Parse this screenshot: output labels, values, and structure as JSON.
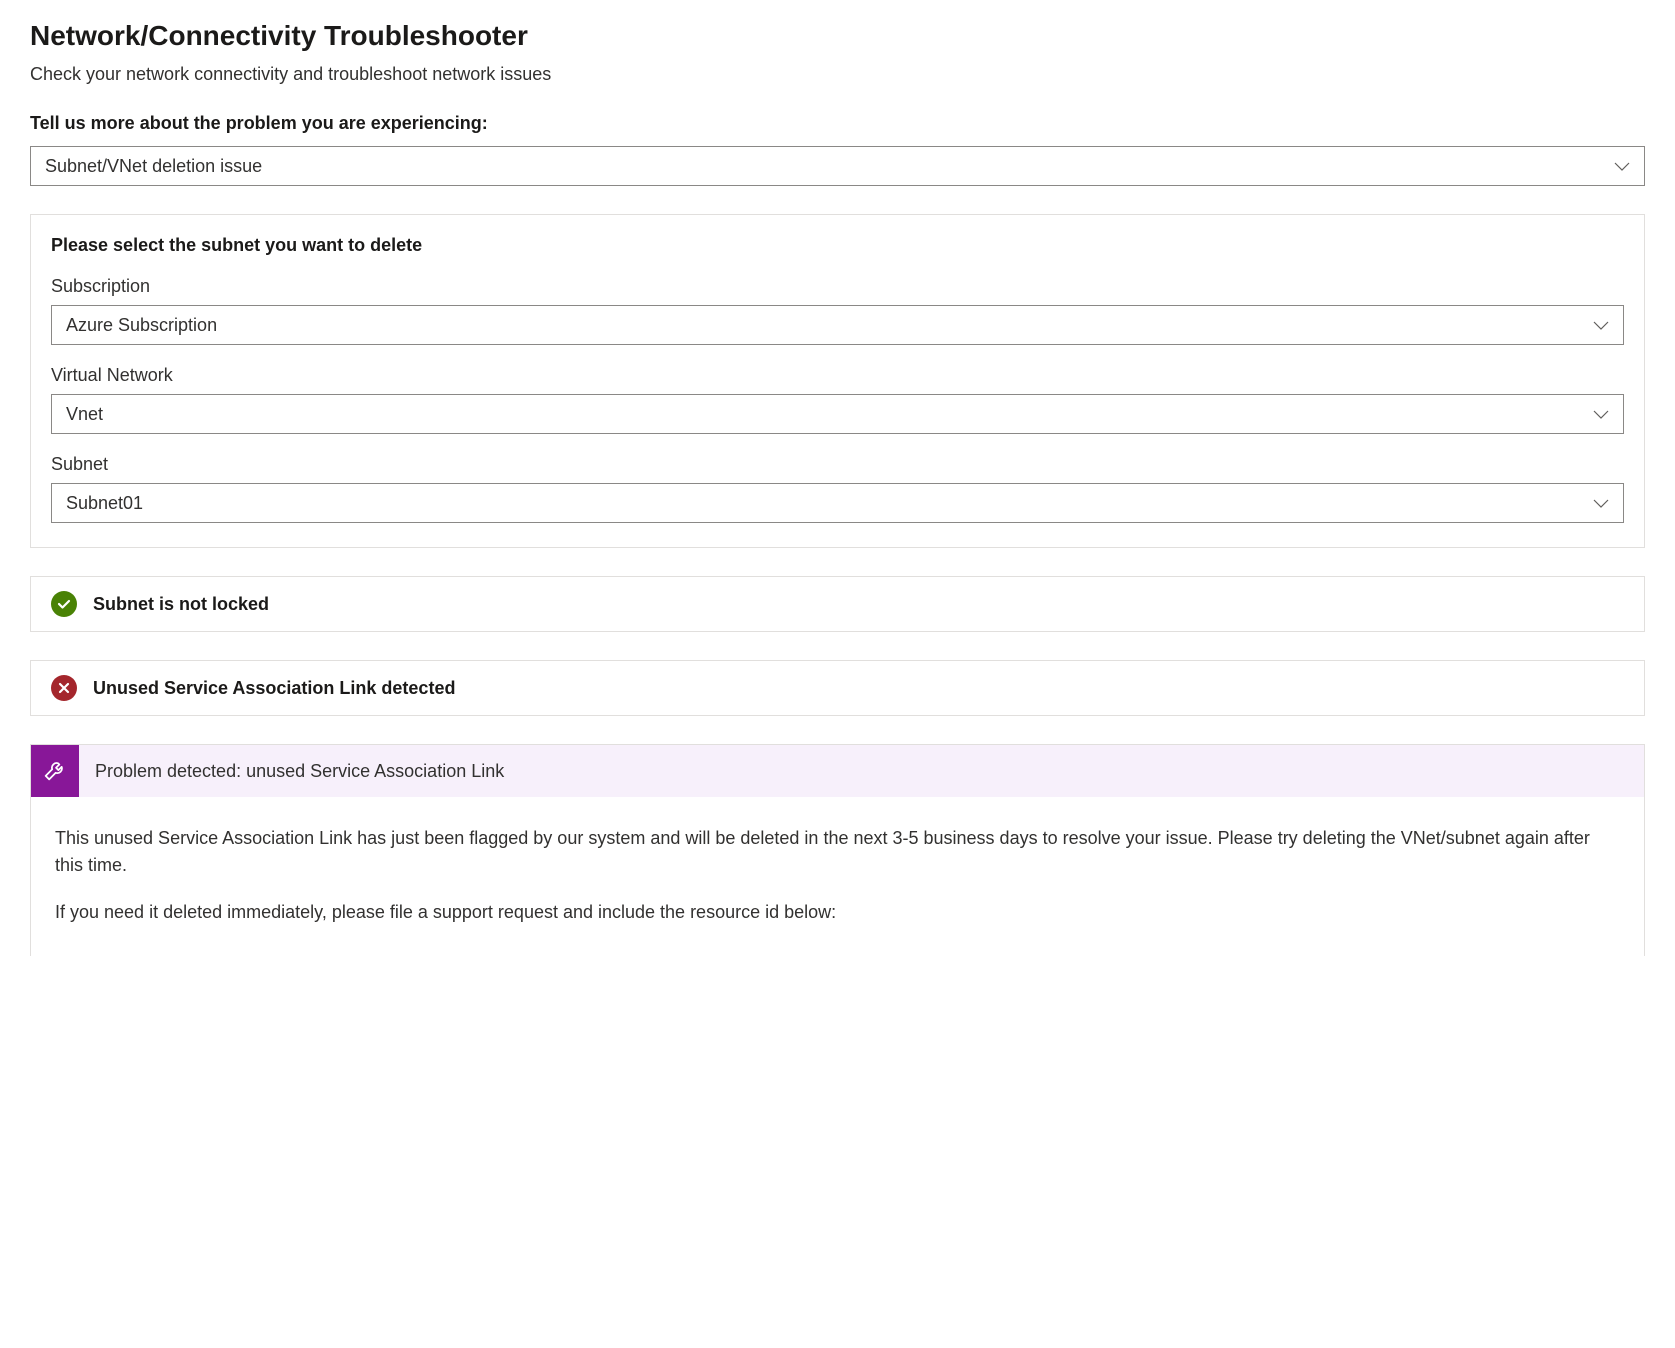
{
  "header": {
    "title": "Network/Connectivity Troubleshooter",
    "subtitle": "Check your network connectivity and troubleshoot network issues"
  },
  "problemSection": {
    "label": "Tell us more about the problem you are experiencing:",
    "selectedValue": "Subnet/VNet deletion issue"
  },
  "subnetCard": {
    "title": "Please select the subnet you want to delete",
    "fields": {
      "subscription": {
        "label": "Subscription",
        "value": "Azure Subscription"
      },
      "virtualNetwork": {
        "label": "Virtual Network",
        "value": "Vnet"
      },
      "subnet": {
        "label": "Subnet",
        "value": "Subnet01"
      }
    }
  },
  "statuses": {
    "notLocked": "Subnet is not locked",
    "unusedSAL": "Unused Service Association Link detected"
  },
  "problemDetected": {
    "title": "Problem detected: unused Service Association Link",
    "body1": "This unused Service Association Link has just been flagged by our system and will be deleted in the next 3-5 business days to resolve your issue. Please try deleting the VNet/subnet again after this time.",
    "body2": "If you need it deleted immediately, please file a support request and include the resource id below:"
  }
}
